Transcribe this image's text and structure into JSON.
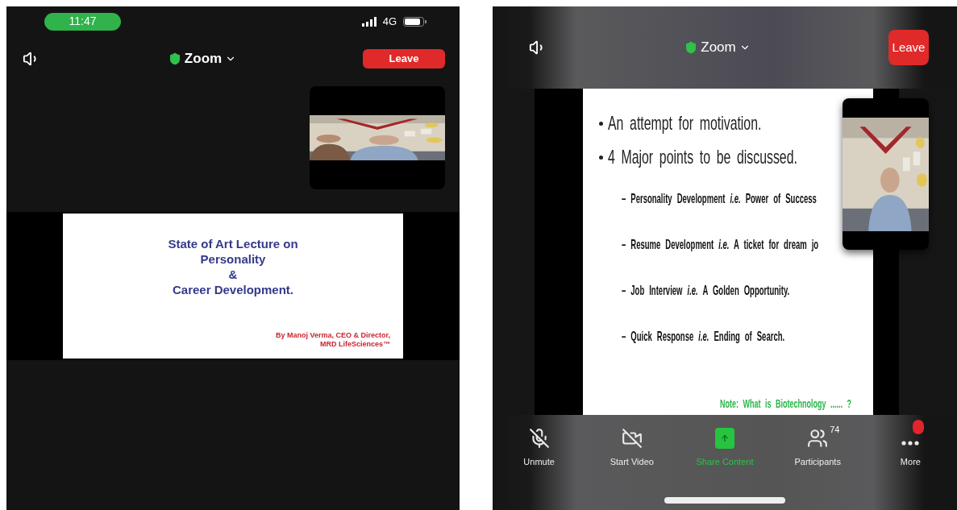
{
  "left_screen": {
    "status_bar": {
      "time": "11:47",
      "network": "4G"
    },
    "top_bar": {
      "meeting_title": "Zoom",
      "leave_button": "Leave"
    },
    "slide": {
      "title_lines": [
        "State of Art Lecture on",
        "Personality",
        "&",
        "Career Development."
      ],
      "byline_lines": [
        "By Manoj Verma, CEO & Director,",
        "MRD LifeSciences™"
      ]
    }
  },
  "right_screen": {
    "top_bar": {
      "meeting_title": "Zoom",
      "leave_button": "Leave"
    },
    "slide": {
      "bullets": [
        "An attempt for motivation.",
        "4 Major points to be discussed."
      ],
      "sub_points": [
        "– Personality Development *i.e.* Power of Success",
        "– Resume Development *i.e.* A ticket for dream jo",
        "– Job Interview *i.e.* A Golden Opportunity.",
        "– Quick Response *i.e.* Ending of Search."
      ],
      "note": "Note: What is Biotechnology ...... ?"
    },
    "toolbar": [
      {
        "kind": "mic",
        "label": "Unmute",
        "off": true,
        "selected": false
      },
      {
        "kind": "video",
        "label": "Start Video",
        "off": true,
        "selected": false
      },
      {
        "kind": "share",
        "label": "Share Content",
        "selected": true
      },
      {
        "kind": "participants",
        "label": "Participants",
        "count": "74",
        "selected": false
      },
      {
        "kind": "more",
        "label": "More",
        "notification": true,
        "selected": false
      }
    ]
  }
}
